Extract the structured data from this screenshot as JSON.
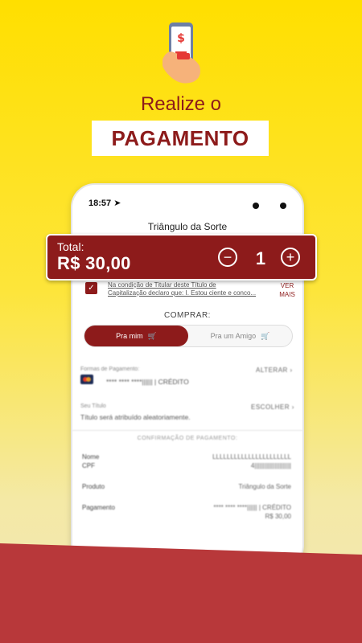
{
  "hero": {
    "line1": "Realize o",
    "tag": "PAGAMENTO"
  },
  "colors": {
    "brand": "#8d1b1b",
    "background": "#ffdf00",
    "band": "#b8383a"
  },
  "phone": {
    "status_time": "18:57 ➤",
    "screen_title": "Triângulo da Sorte",
    "terms_line1": "Na condição de Titular deste Título de",
    "terms_line2": "Capitalização declaro que: I. Estou ciente e conco...",
    "ver_label": "VER",
    "mais_label": "MAIS",
    "comprar_label": "COMPRAR:",
    "tabs": {
      "self": "Pra mim",
      "friend": "Pra um Amigo"
    },
    "payment": {
      "label": "Formas de Pagamento:",
      "alterar": "ALTERAR",
      "card": "**** **** ****|||||| | CRÉDITO"
    },
    "titulo": {
      "label": "Seu Título",
      "escolher": "ESCOLHER",
      "text": "Título será atribuído aleatoriamente."
    },
    "confirmation": {
      "title": "CONFIRMAÇÃO DE PAGAMENTO:",
      "nome_label": "Nome",
      "nome_value": "LLLLLLLLLLLLLLLLLLLLLL",
      "cpf_label": "CPF",
      "cpf_value": "4||||||||||||||||||||||",
      "produto_label": "Produto",
      "produto_value": "Triângulo da Sorte",
      "pagamento_label": "Pagamento",
      "pagamento_value": "**** **** ****|||||| | CRÉDITO",
      "pagamento_amount": "R$ 30,00"
    }
  },
  "total": {
    "label": "Total:",
    "value": "R$ 30,00",
    "quantity": "1"
  }
}
